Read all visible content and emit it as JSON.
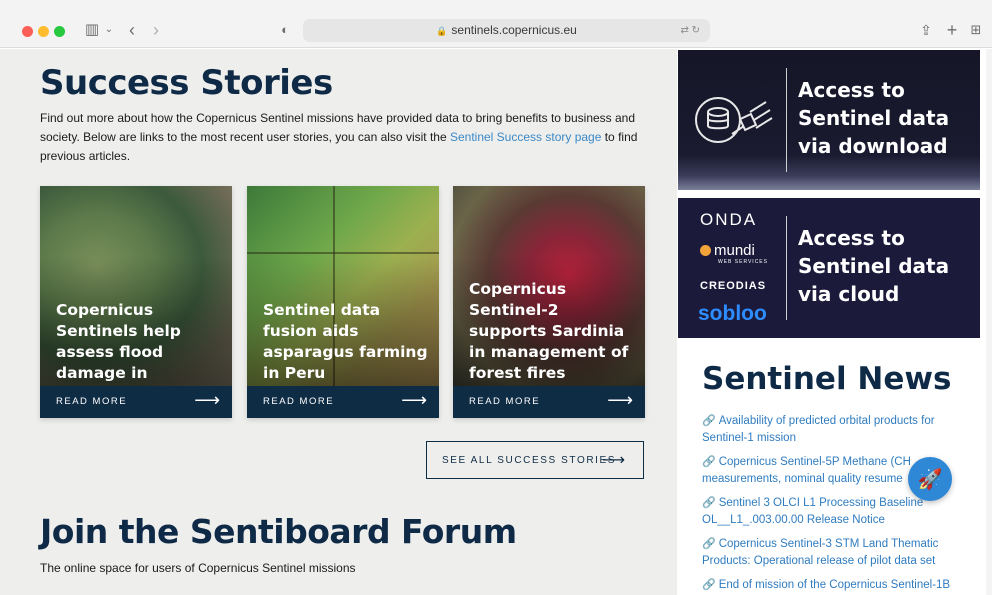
{
  "browser": {
    "url": "sentinels.copernicus.eu",
    "icons": [
      "sidebar-icon",
      "chevron-down-icon",
      "back-icon",
      "forward-icon",
      "shield-icon",
      "translate-icon",
      "reload-icon",
      "share-icon",
      "plus-icon",
      "tabs-icon"
    ]
  },
  "main": {
    "title": "Success Stories",
    "intro_before_link": "Find out more about how the Copernicus Sentinel missions have provided data to bring benefits to business and society. Below are links to the most recent user stories, you can also visit the ",
    "intro_link": "Sentinel Success story page",
    "intro_after_link": " to find previous articles.",
    "cards": [
      {
        "title": "Copernicus Sentinels help assess flood damage in Pakistan",
        "read_more": "READ MORE"
      },
      {
        "title": "Sentinel data fusion aids asparagus farming in Peru",
        "read_more": "READ MORE"
      },
      {
        "title": "Copernicus Sentinel-2 supports Sardinia in management of forest fires",
        "read_more": "READ MORE"
      }
    ],
    "see_all": "SEE ALL SUCCESS STORIES",
    "forum_title": "Join the Sentiboard Forum",
    "forum_sub": "The online space for users of Copernicus Sentinel missions"
  },
  "sidebar": {
    "banner1": "Access to Sentinel data via download",
    "banner2": "Access to Sentinel data via cloud",
    "providers": {
      "onda": "ONDA",
      "mundi": "mundi",
      "mundi_sub": "WEB SERVICES",
      "creodias": "CREODIAS",
      "sobloo": "sobloo"
    },
    "news_title": "Sentinel News",
    "news": [
      "Availability of predicted orbital products for Sentinel-1 mission",
      "Copernicus Sentinel-5P Methane (CH measurements, nominal quality resume",
      "Sentinel 3 OLCI L1 Processing Baseline OL__L1_.003.00.00 Release Notice",
      "Copernicus Sentinel-3 STM Land Thematic Products: Operational release of pilot data set",
      "End of mission of the Copernicus Sentinel-1B"
    ]
  },
  "colors": {
    "brand_navy": "#0e2a47",
    "link_blue": "#2f7cc0",
    "fab_blue": "#2e88d6"
  }
}
